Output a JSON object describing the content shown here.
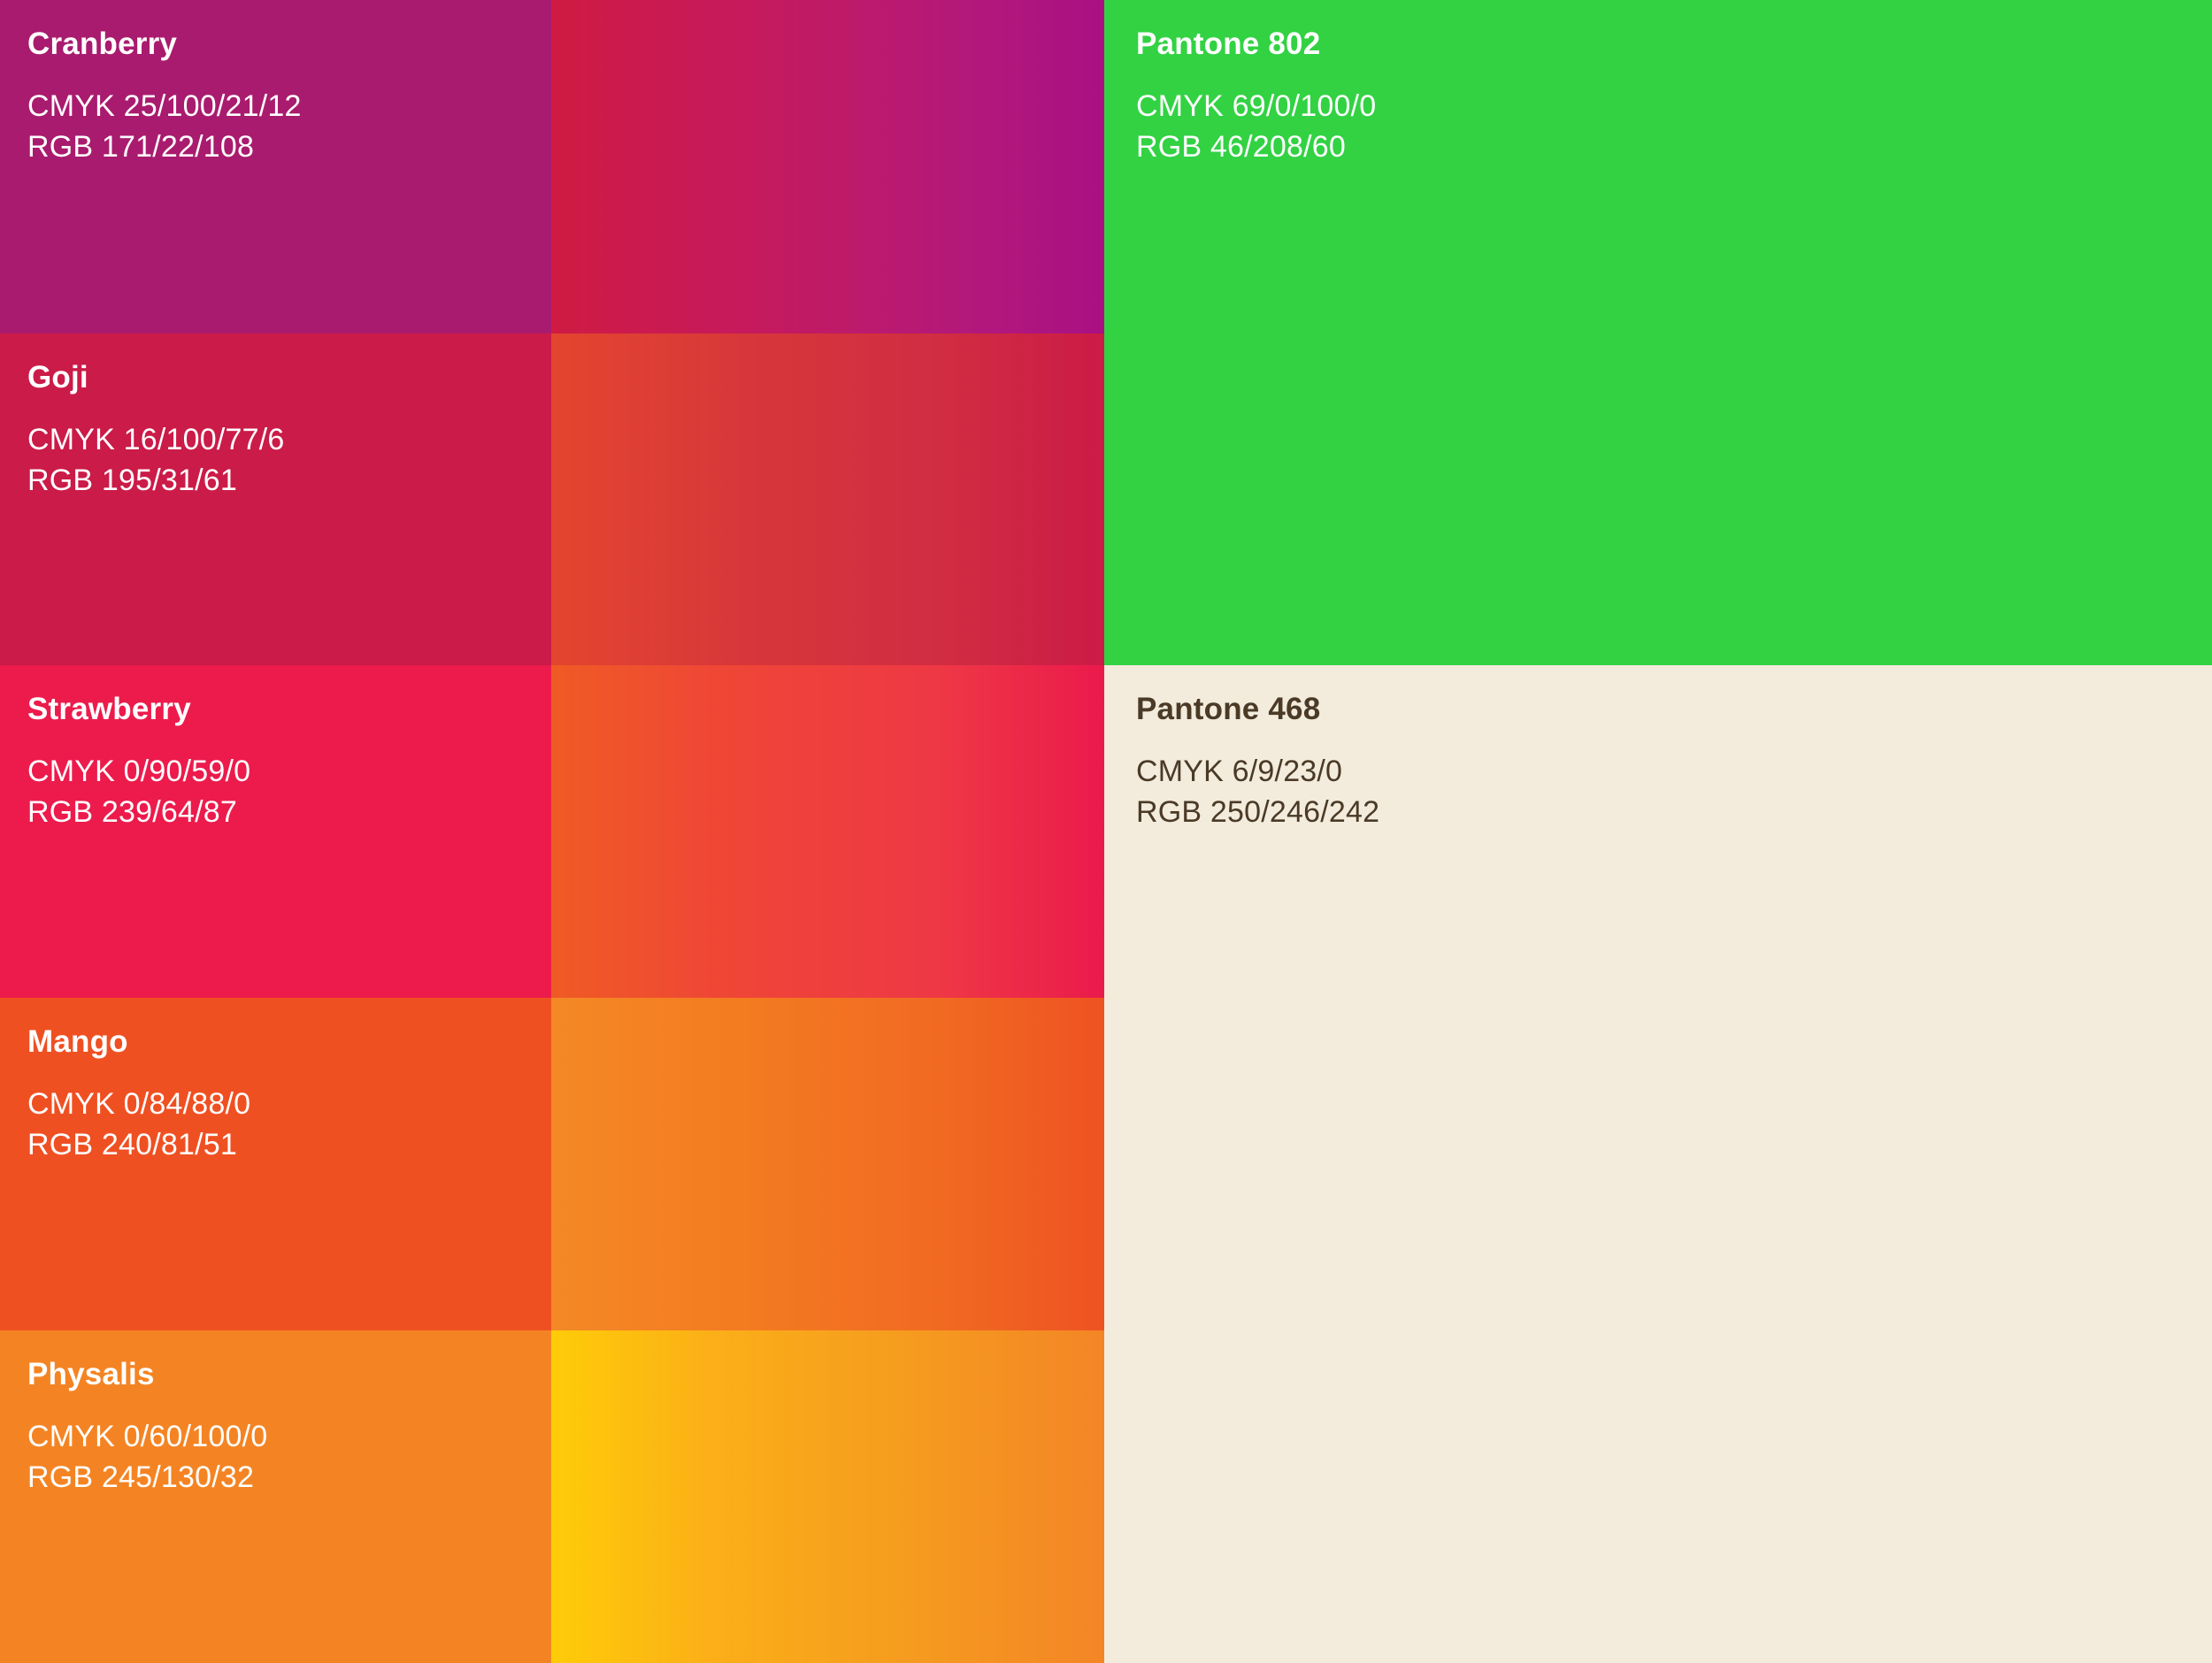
{
  "palette": {
    "fruits": [
      {
        "name": "Cranberry",
        "cmyk": "CMYK 25/100/21/12",
        "rgb": "RGB 171/22/108",
        "color": "#a91b6e",
        "gradient": [
          "#cf1b43",
          "#c61a5c",
          "#b3197a",
          "#aa1082"
        ]
      },
      {
        "name": "Goji",
        "cmyk": "CMYK 16/100/77/6",
        "rgb": "RGB 195/31/61",
        "color": "#cb1b48",
        "gradient": [
          "#e3452f",
          "#d7373a",
          "#d02d42",
          "#cc1b47"
        ]
      },
      {
        "name": "Strawberry",
        "cmyk": "CMYK 0/90/59/0",
        "rgb": "RGB 239/64/87",
        "color": "#ec1b4c",
        "gradient": [
          "#ef5b24",
          "#ef4636",
          "#ee3845",
          "#eb1a4c"
        ]
      },
      {
        "name": "Mango",
        "cmyk": "CMYK 0/84/88/0",
        "rgb": "RGB 240/81/51",
        "color": "#ef5022",
        "gradient": [
          "#f48825",
          "#f37b21",
          "#f16a22",
          "#ee5222"
        ]
      },
      {
        "name": "Physalis",
        "cmyk": "CMYK 0/60/100/0",
        "rgb": "RGB 245/130/32",
        "color": "#f48423",
        "gradient": [
          "#ffcc08",
          "#fbae18",
          "#f59b1f",
          "#f48526"
        ]
      }
    ],
    "pantones": [
      {
        "name": "Pantone 802",
        "cmyk": "CMYK 69/0/100/0",
        "rgb": "RGB 46/208/60",
        "color": "#32d243",
        "text_color": "#ffffff"
      },
      {
        "name": "Pantone 468",
        "cmyk": "CMYK 6/9/23/0",
        "rgb": "RGB 250/246/242",
        "color": "#f3ecdd",
        "text_color": "#4a3a26"
      }
    ]
  }
}
